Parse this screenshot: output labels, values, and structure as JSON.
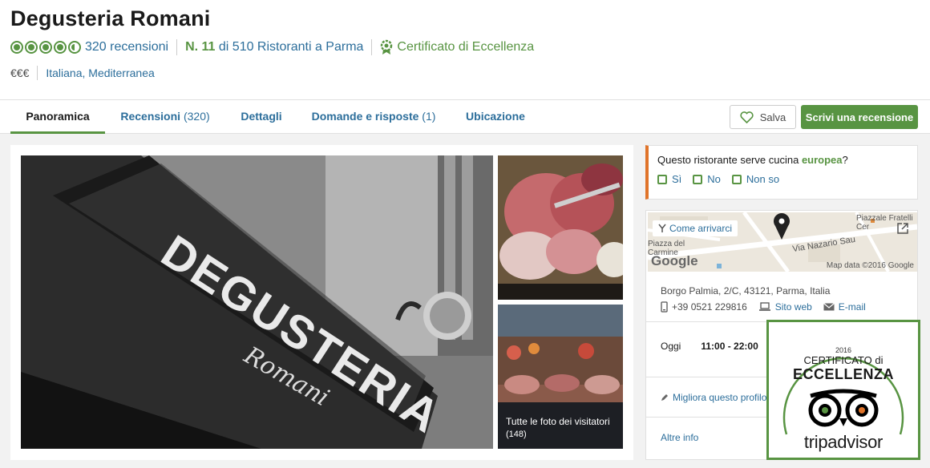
{
  "restaurant": {
    "name": "Degusteria Romani",
    "reviews_count_label": "320 recensioni",
    "rating": 4.5,
    "rank_number": "N. 11",
    "rank_rest": "di 510 Ristoranti a Parma",
    "certificate": "Certificato di Eccellenza",
    "price": "€€€",
    "cuisine": "Italiana, Mediterranea"
  },
  "tabs": [
    {
      "label": "Panoramica",
      "count": ""
    },
    {
      "label": "Recensioni",
      "count": "(320)"
    },
    {
      "label": "Dettagli",
      "count": ""
    },
    {
      "label": "Domande e risposte",
      "count": "(1)"
    },
    {
      "label": "Ubicazione",
      "count": ""
    }
  ],
  "actions": {
    "save_label": "Salva",
    "write_label": "Scrivi una recensione"
  },
  "photos": {
    "sign_text": "DEGUSTERIA",
    "sign_script": "Romani",
    "all_photos_label": "Tutte le foto dei visitatori",
    "all_photos_count": "(148)"
  },
  "question": {
    "prefix": "Questo ristorante serve cucina",
    "highlight": "europea",
    "suffix": "?",
    "options": [
      "Sì",
      "No",
      "Non so"
    ]
  },
  "location": {
    "directions_label": "Come arrivarci",
    "map_labels": [
      "Piazzale Fratelli Cer",
      "Piazza del Carmine",
      "Via Nazario Sau"
    ],
    "map_brand": "Google",
    "map_credit": "Map data ©2016 Google",
    "address": "Borgo Palmia, 2/C, 43121, Parma, Italia",
    "phone": "+39 0521 229816",
    "website_label": "Sito web",
    "email_label": "E-mail",
    "today_label": "Oggi",
    "today_hours": "11:00 - 22:00",
    "improve_label": "Migliora questo profilo",
    "more_label": "Altre info"
  },
  "badge": {
    "year": "2016",
    "line1": "CERTIFICATO di",
    "line2": "ECCELLENZA",
    "brand": "tripadvisor"
  },
  "colors": {
    "brand_green": "#589442",
    "link_blue": "#2c6e9b",
    "accent_orange": "#e0742a"
  }
}
